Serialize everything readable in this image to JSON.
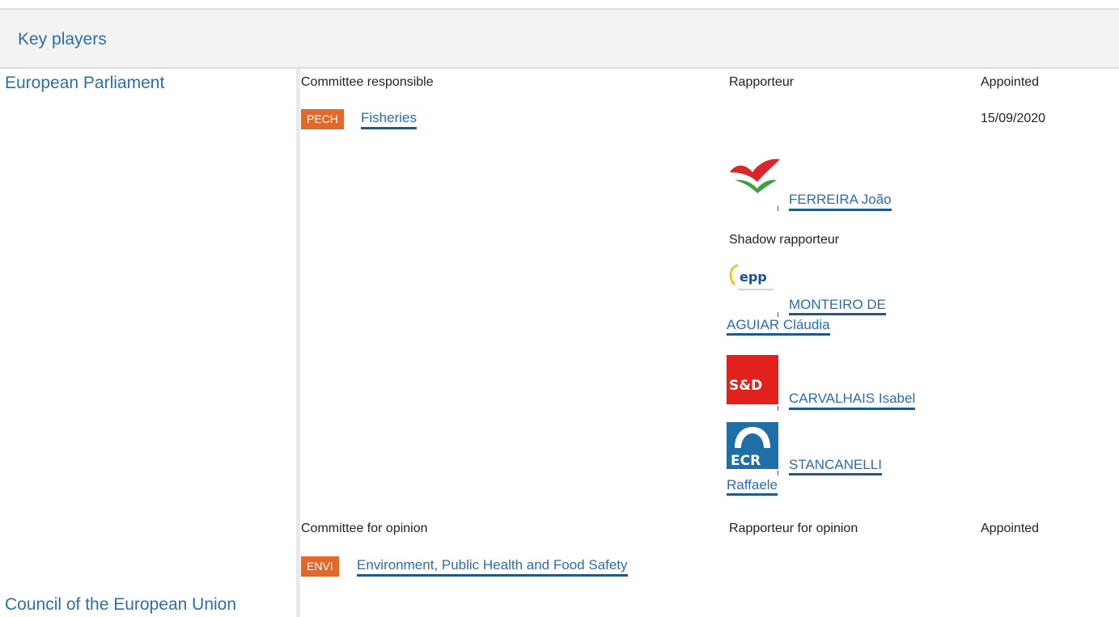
{
  "header": {
    "title": "Key players"
  },
  "institutions": {
    "ep": "European Parliament",
    "council": "Council of the European Union"
  },
  "committee_responsible": {
    "col_committee": "Committee responsible",
    "col_rapporteur": "Rapporteur",
    "col_appointed": "Appointed",
    "badge": "PECH",
    "name": "Fisheries",
    "appointed_date": "15/09/2020",
    "rapporteur": {
      "name": "FERREIRA João",
      "group_icon": "gue-ngl-logo"
    },
    "shadow_label": "Shadow rapporteur",
    "shadows": [
      {
        "line1": "MONTEIRO DE",
        "line2": "AGUIAR Cláudia",
        "group_icon": "epp-logo",
        "logo_text": "epp"
      },
      {
        "line1": "CARVALHAIS Isabel",
        "group_icon": "sd-logo",
        "logo_text": "S&D"
      },
      {
        "line1": "STANCANELLI",
        "line2": "Raffaele",
        "group_icon": "ecr-logo",
        "logo_text": "ECR"
      }
    ]
  },
  "committee_opinion": {
    "col_committee": "Committee for opinion",
    "col_rapporteur": "Rapporteur for opinion",
    "col_appointed": "Appointed",
    "badge": "ENVI",
    "name": "Environment, Public Health and Food Safety"
  },
  "colors": {
    "link": "#2a6db0",
    "badge": "#e06a2b",
    "header_bg": "#f3f3f3"
  }
}
